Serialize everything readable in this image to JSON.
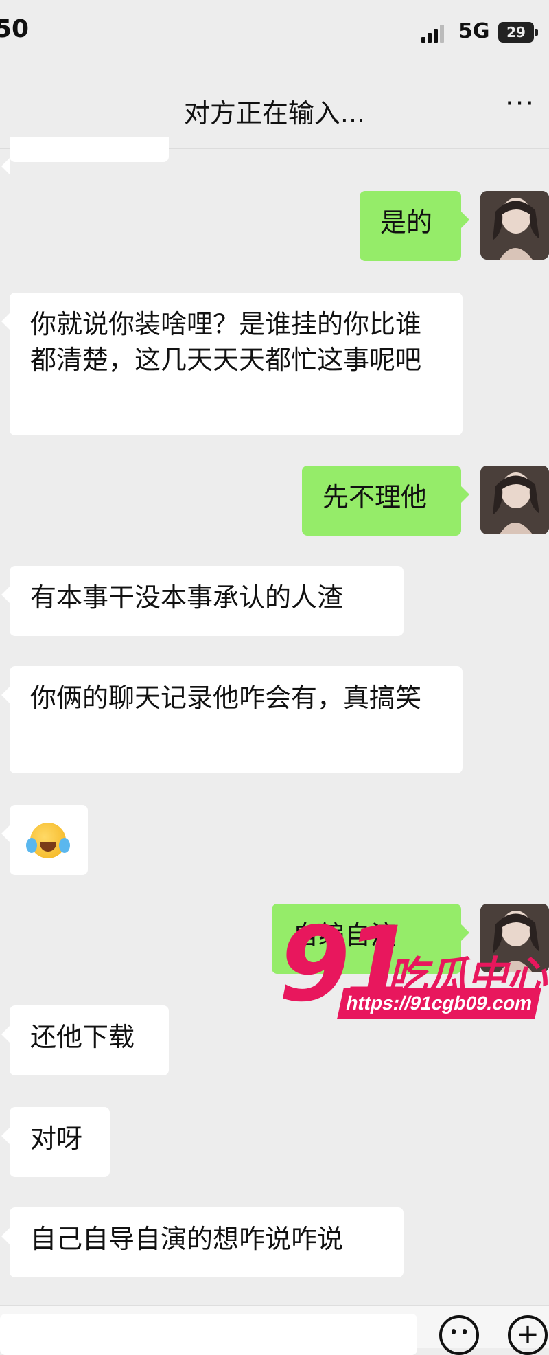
{
  "status": {
    "time": "50",
    "network": "5G",
    "battery": "29"
  },
  "header": {
    "title": "对方正在输入...",
    "more": "···"
  },
  "messages": [
    {
      "side": "out",
      "text": "是的"
    },
    {
      "side": "in",
      "text": "你就说你装啥哩？是谁挂的你比谁都清楚，这几天天天都忙这事呢吧"
    },
    {
      "side": "out",
      "text": "先不理他"
    },
    {
      "side": "in",
      "text": "有本事干没本事承认的人渣"
    },
    {
      "side": "in",
      "text": "你俩的聊天记录他咋会有，真搞笑"
    },
    {
      "side": "in",
      "emoji": "laughing-crying-emoji"
    },
    {
      "side": "out",
      "text": "自编自演"
    },
    {
      "side": "in",
      "text": "还他下载"
    },
    {
      "side": "in",
      "text": "对呀"
    },
    {
      "side": "in",
      "text": "自己自导自演的想咋说咋说"
    }
  ],
  "watermark": {
    "number": "91",
    "name": "吃瓜中心",
    "url": "https://91cgb09.com"
  },
  "input": {
    "placeholder": ""
  },
  "colors": {
    "out_bubble": "#95ec69",
    "in_bubble": "#ffffff",
    "background": "#ededed",
    "watermark": "#e8175d"
  }
}
